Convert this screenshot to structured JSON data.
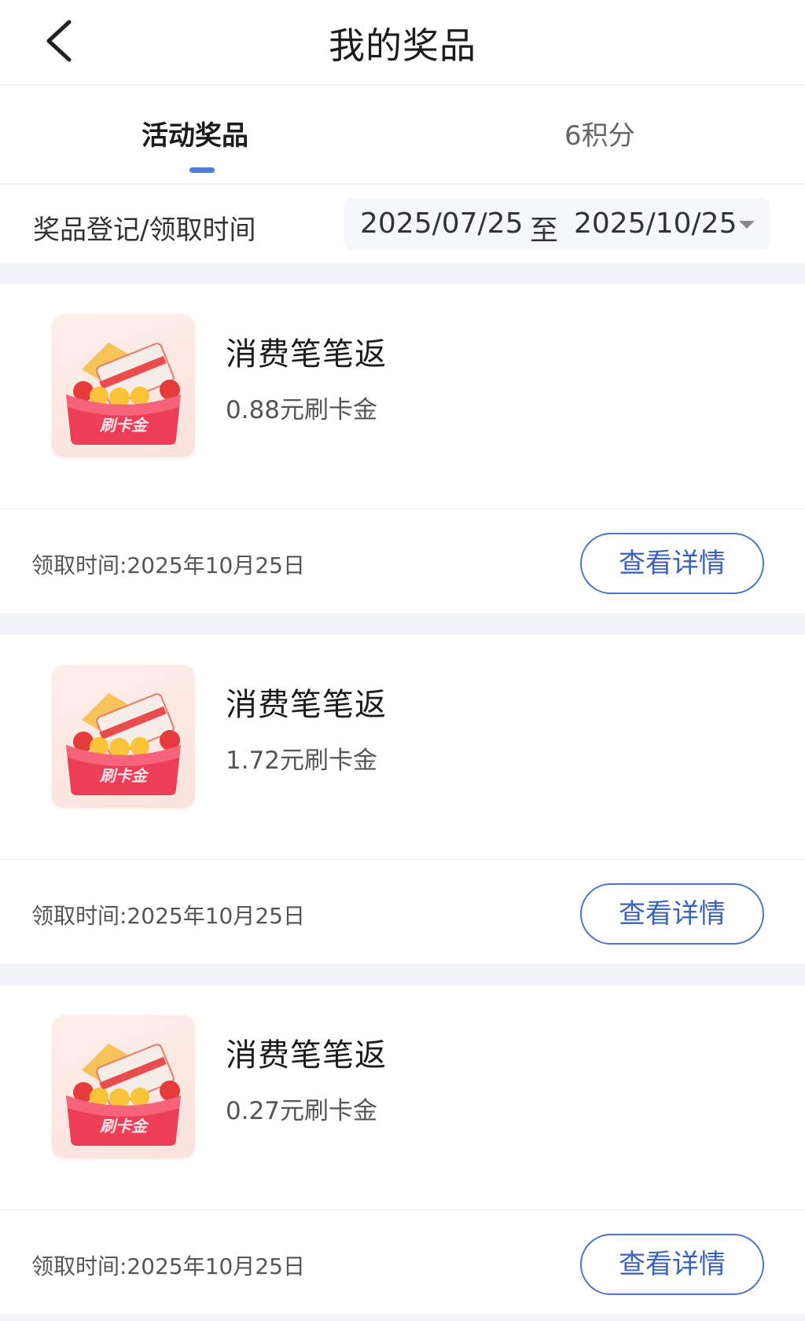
{
  "header": {
    "title": "我的奖品",
    "back_icon": "chevron-left-icon"
  },
  "tabs": [
    {
      "label": "活动奖品",
      "active": true
    },
    {
      "label": "6积分",
      "active": false
    }
  ],
  "filter": {
    "label": "奖品登记/领取时间",
    "start": "2025/07/25",
    "separator": "至",
    "end": "2025/10/25"
  },
  "colors": {
    "accent": "#4a7ee0",
    "button_border": "#4a74c8",
    "brand_red": "#e8394a"
  },
  "prizes": [
    {
      "name": "消费笔笔返",
      "amount": "0.88元刷卡金",
      "thumb_label": "刷卡金",
      "claim_time": "领取时间:2025年10月25日",
      "button": "查看详情"
    },
    {
      "name": "消费笔笔返",
      "amount": "1.72元刷卡金",
      "thumb_label": "刷卡金",
      "claim_time": "领取时间:2025年10月25日",
      "button": "查看详情"
    },
    {
      "name": "消费笔笔返",
      "amount": "0.27元刷卡金",
      "thumb_label": "刷卡金",
      "claim_time": "领取时间:2025年10月25日",
      "button": "查看详情"
    }
  ]
}
